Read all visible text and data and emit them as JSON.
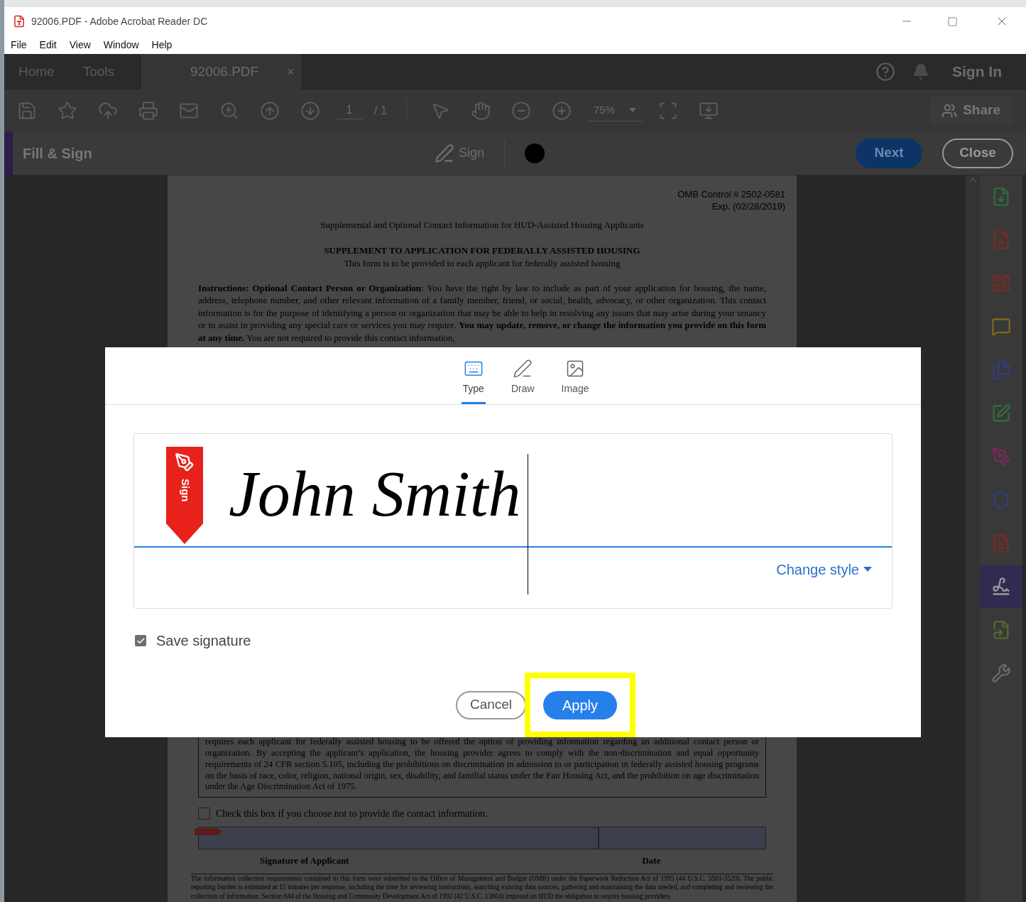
{
  "window": {
    "title": "92006.PDF - Adobe Acrobat Reader DC"
  },
  "menu": [
    "File",
    "Edit",
    "View",
    "Window",
    "Help"
  ],
  "tabs": [
    {
      "label": "Home",
      "selected": false
    },
    {
      "label": "Tools",
      "selected": false
    },
    {
      "label": "92006.PDF",
      "selected": true,
      "close": "×"
    }
  ],
  "account": {
    "sign_in": "Sign In"
  },
  "toolbar": {
    "page": "1",
    "page_total": "/ 1",
    "zoom": "75%",
    "share": "Share"
  },
  "fill_sign": {
    "title": "Fill & Sign",
    "sign": "Sign",
    "next": "Next",
    "close": "Close"
  },
  "document": {
    "control": "OMB Control # 2502-0581",
    "expires": "Exp. (02/28/2019)",
    "subtitle": "Supplemental and Optional Contact Information for HUD-Assisted Housing Applicants",
    "heading": "SUPPLEMENT TO APPLICATION FOR FEDERALLY ASSISTED HOUSING",
    "note": "This form is to be provided to each applicant for federally assisted housing",
    "instructions": "**Instructions:  Optional Contact Person or Organization**: You have the right by law to include as part of your application for housing, the name, address, telephone number, and other relevant information of a family member, friend, or social, health, advocacy, or other organization.  This contact information is for the purpose of identifying a person or organization that may be able to help in resolving any issues that may arise during your tenancy or to assist in providing any special care or services you may require.  **You may update, remove, or change the information you provide on this form at any time.**  You are not required to provide this contact information,",
    "box_text": "requires each applicant for federally assisted housing to be offered the option of providing information regarding an additional contact person or organization. By accepting the applicant’s application, the housing provider agrees to comply with the non-discrimination and equal opportunity requirements of 24 CFR section 5.105, including the prohibitions on discrimination in admission to or participation in federally assisted housing programs on the basis of race, color, religion, national origin, sex, disability, and familial status under the Fair Housing Act, and the prohibition on age discrimination under the Age Discrimination Act of 1975.",
    "opt_out": {
      "label": "Check this box if you choose not to provide the contact information.",
      "checked": false
    },
    "signature_label": "Signature of Applicant",
    "date_label": "Date",
    "footer": "The information collection requirements contained in this form were submitted to the Office of Management and Budget (OMB) under the Paperwork Reduction Act of 1995 (44 U.S.C. 3501-3520).  The public reporting burden is estimated at 15 minutes per response, including the time for reviewing instructions, searching existing data sources, gathering and maintaining the data needed, and completing and reviewing the collection of information.  Section 644 of the Housing and Community Development Act of 1992 (42 U.S.C. 13604) imposed on HUD the obligation to require housing providers"
  },
  "dialog": {
    "tabs": [
      {
        "kind": "type",
        "label": "Type",
        "selected": true
      },
      {
        "kind": "draw",
        "label": "Draw",
        "selected": false
      },
      {
        "kind": "image",
        "label": "Image",
        "selected": false
      }
    ],
    "badge": "Sign",
    "signature": "John Smith",
    "change_style": "Change style",
    "save_signature": {
      "label": "Save signature",
      "checked": true
    },
    "cancel": "Cancel",
    "apply": "Apply"
  },
  "sidebar": {
    "tools": [
      {
        "kind": "export",
        "color": "#2f6b3e",
        "selected": false
      },
      {
        "kind": "create",
        "color": "#7a2a26",
        "selected": false
      },
      {
        "kind": "organize",
        "color": "#7a2a26",
        "selected": false
      },
      {
        "kind": "comment",
        "color": "#7a6a1c",
        "selected": false
      },
      {
        "kind": "combine",
        "color": "#2f3f80",
        "selected": false
      },
      {
        "kind": "edit",
        "color": "#2f6b3e",
        "selected": false
      },
      {
        "kind": "sign",
        "color": "#7a2a58",
        "selected": false
      },
      {
        "kind": "protect",
        "color": "#2f3f80",
        "selected": false
      },
      {
        "kind": "pdf",
        "color": "#7a2a26",
        "selected": false
      },
      {
        "kind": "fill",
        "color": "#9a9a9a",
        "selected": true
      },
      {
        "kind": "send",
        "color": "#4f6b2e",
        "selected": false
      },
      {
        "kind": "more",
        "color": "#6a6a6a",
        "selected": false
      }
    ]
  }
}
